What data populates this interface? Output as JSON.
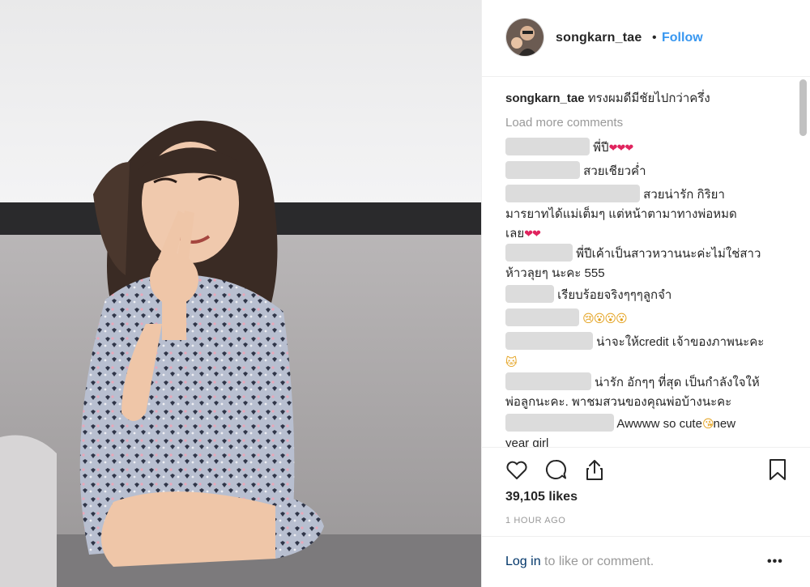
{
  "post": {
    "username": "songkarn_tae",
    "follow_label": "Follow",
    "separator": "•",
    "caption": "ทรงผมดีมีชัยไปกว่าครึ่ง",
    "load_more": "Load more comments",
    "likes": "39,105 likes",
    "time": "1 HOUR AGO"
  },
  "comments": [
    {
      "text": "พี่ปี",
      "suffix": "❤❤❤"
    },
    {
      "text": "สวยเชียวค่ำ"
    },
    {
      "text": "สวยน่ารัก กิริยา",
      "line2": "มารยาทได้แม่เต็มๆ แต่หน้าตามาทางพ่อหมด",
      "line3": "เลย",
      "suffix": "❤❤"
    },
    {
      "text": "พี่ปีเค้าเป็นสาวหวานนะค่ะไม่ใช่สาว",
      "line2": "ห้าวลุยๆ นะคะ 555"
    },
    {
      "text": "เรียบร้อยจริงๆๆๆลูกจำ"
    },
    {
      "text": "",
      "suffix": "😢😮😮😮"
    },
    {
      "text": "น่าจะให้credit เจ้าของภาพนะคะ",
      "line2": "🐱"
    },
    {
      "text": "น่ารัก อักๆๆ ที่สุด เป็นกำลังใจให้",
      "line2": "พ่อลูกนะคะ. พาชมสวนของคุณพ่อบ้างนะคะ"
    },
    {
      "text": "Awwww so cute",
      "suffix": "😘",
      "after": "new",
      "line2": "year girl"
    }
  ],
  "footer": {
    "login_link": "Log in",
    "login_rest": " to like or comment.",
    "more": "•••"
  },
  "icons": {
    "like": "heart-icon",
    "comment": "comment-bubble-icon",
    "share": "share-icon",
    "save": "bookmark-icon",
    "more": "more-options-icon"
  },
  "colors": {
    "accent": "#3897f0",
    "link": "#003569",
    "heart": "#e0245e"
  }
}
